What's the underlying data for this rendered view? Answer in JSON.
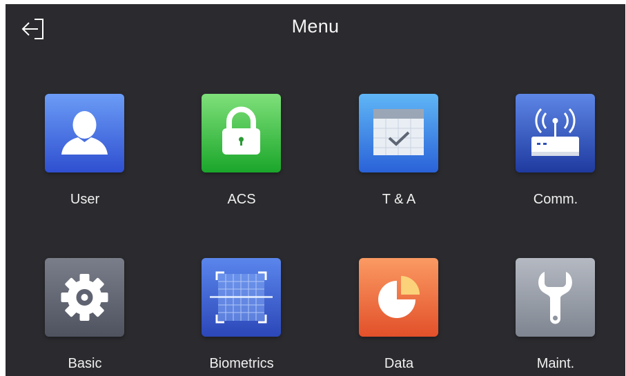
{
  "header": {
    "title": "Menu",
    "back_icon": "back-arrow-icon"
  },
  "colors": {
    "background": "#2b2b2f",
    "user": "#4a78e8",
    "acs": "#2fbf3c",
    "ta": "#2f84e0",
    "comm": "#3554b7",
    "basic": "#5f6371",
    "biometrics": "#3a5fd6",
    "data": "#f06a3a",
    "maint": "#8e949e"
  },
  "menu": {
    "items": [
      {
        "label": "User",
        "icon": "user-icon"
      },
      {
        "label": "ACS",
        "icon": "padlock-icon"
      },
      {
        "label": "T & A",
        "icon": "calendar-check-icon"
      },
      {
        "label": "Comm.",
        "icon": "router-signal-icon"
      },
      {
        "label": "Basic",
        "icon": "gear-icon"
      },
      {
        "label": "Biometrics",
        "icon": "face-scan-icon"
      },
      {
        "label": "Data",
        "icon": "pie-chart-icon"
      },
      {
        "label": "Maint.",
        "icon": "wrench-icon"
      }
    ]
  }
}
